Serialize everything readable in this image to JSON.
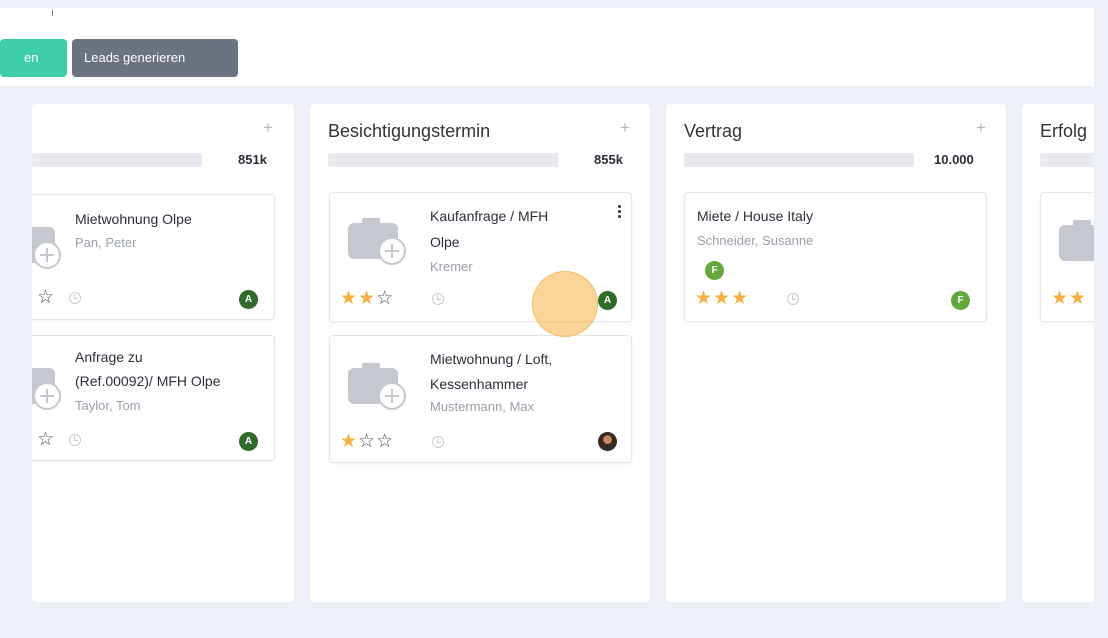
{
  "toolbar": {
    "partial_button_label": "en",
    "generate_leads_label": "Leads generieren",
    "accent_color": "#3fcfa8"
  },
  "columns": [
    {
      "title": "",
      "sum": "851k",
      "cards": [
        {
          "title_lines": [
            "Mietwohnung Olpe"
          ],
          "subtitle": "Pan, Peter",
          "stars": 0,
          "avatar": "A"
        },
        {
          "title_lines": [
            "Anfrage zu",
            "(Ref.00092)/ MFH Olpe"
          ],
          "subtitle": "Taylor, Tom",
          "stars": 0,
          "avatar": "A"
        }
      ]
    },
    {
      "title": "Besichtigungstermin",
      "sum": "855k",
      "cards": [
        {
          "title_lines": [
            "Kaufanfrage / MFH",
            "Olpe"
          ],
          "subtitle": "Kremer",
          "stars": 2,
          "avatar": "A"
        },
        {
          "title_lines": [
            "Mietwohnung / Loft,",
            "Kessenhammer"
          ],
          "subtitle": "Mustermann, Max",
          "stars": 1,
          "avatar": ""
        }
      ]
    },
    {
      "title": "Vertrag",
      "sum": "10.000",
      "cards": [
        {
          "title_lines": [
            "Miete / House Italy"
          ],
          "subtitle": "Schneider, Susanne",
          "stars": 3,
          "avatar": "F",
          "tag_avatar": "F"
        }
      ]
    },
    {
      "title": "Erfolg",
      "sum": "",
      "cards": [
        {
          "stars": 2
        }
      ]
    }
  ],
  "icons": {
    "add": "+",
    "star_filled": "★",
    "star_empty": "☆"
  }
}
